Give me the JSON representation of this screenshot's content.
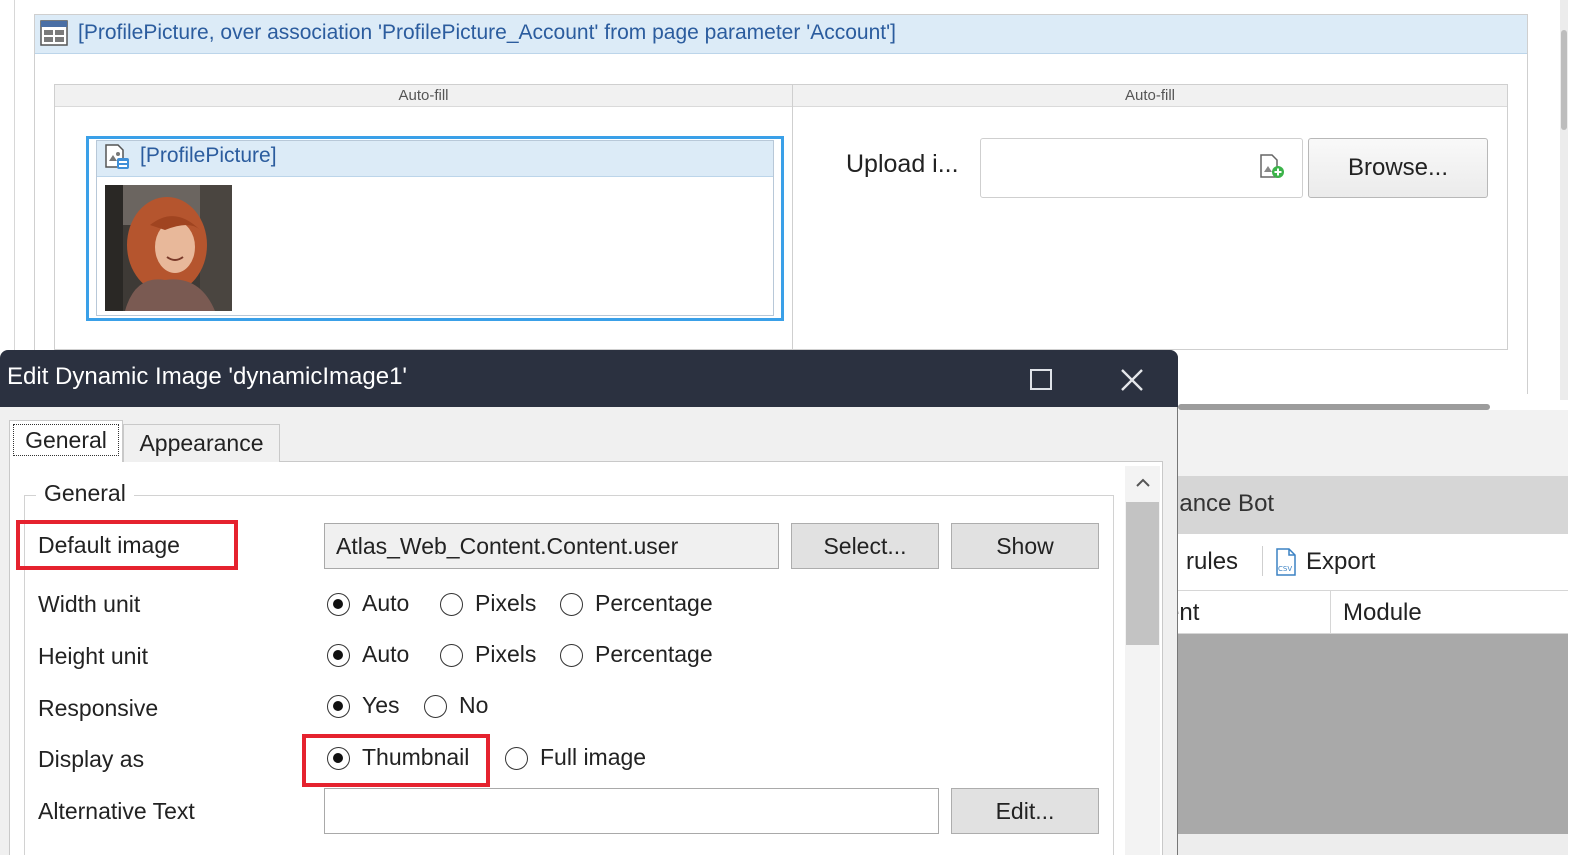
{
  "dataview": {
    "title": "[ProfilePicture, over association 'ProfilePicture_Account' from page parameter 'Account']",
    "columns": [
      "Auto-fill",
      "Auto-fill"
    ],
    "image_widget_title": "[ProfilePicture]",
    "upload_label": "Upload i...",
    "browse_label": "Browse..."
  },
  "performance_bot": {
    "title": "nance Bot",
    "toolbar": {
      "rules": "n rules",
      "export": "Export"
    },
    "columns": [
      "ent",
      "Module"
    ]
  },
  "dialog": {
    "title": "Edit Dynamic Image 'dynamicImage1'",
    "tabs": [
      "General",
      "Appearance"
    ],
    "group_title": "General",
    "fields": {
      "default_image": {
        "label": "Default image",
        "value": "Atlas_Web_Content.Content.user",
        "select_label": "Select...",
        "show_label": "Show"
      },
      "width_unit": {
        "label": "Width unit",
        "options": [
          "Auto",
          "Pixels",
          "Percentage"
        ],
        "selected": "Auto"
      },
      "height_unit": {
        "label": "Height unit",
        "options": [
          "Auto",
          "Pixels",
          "Percentage"
        ],
        "selected": "Auto"
      },
      "responsive": {
        "label": "Responsive",
        "options": [
          "Yes",
          "No"
        ],
        "selected": "Yes"
      },
      "display_as": {
        "label": "Display as",
        "options": [
          "Thumbnail",
          "Full image"
        ],
        "selected": "Thumbnail"
      },
      "alternative_text": {
        "label": "Alternative Text",
        "value": "",
        "edit_label": "Edit..."
      }
    }
  },
  "colors": {
    "dialog_titlebar": "#2b3140",
    "header_blue": "#dcebf7",
    "link_blue": "#2b5c9e",
    "selection_blue": "#3aa0e8",
    "highlight_red": "#e5222e"
  }
}
